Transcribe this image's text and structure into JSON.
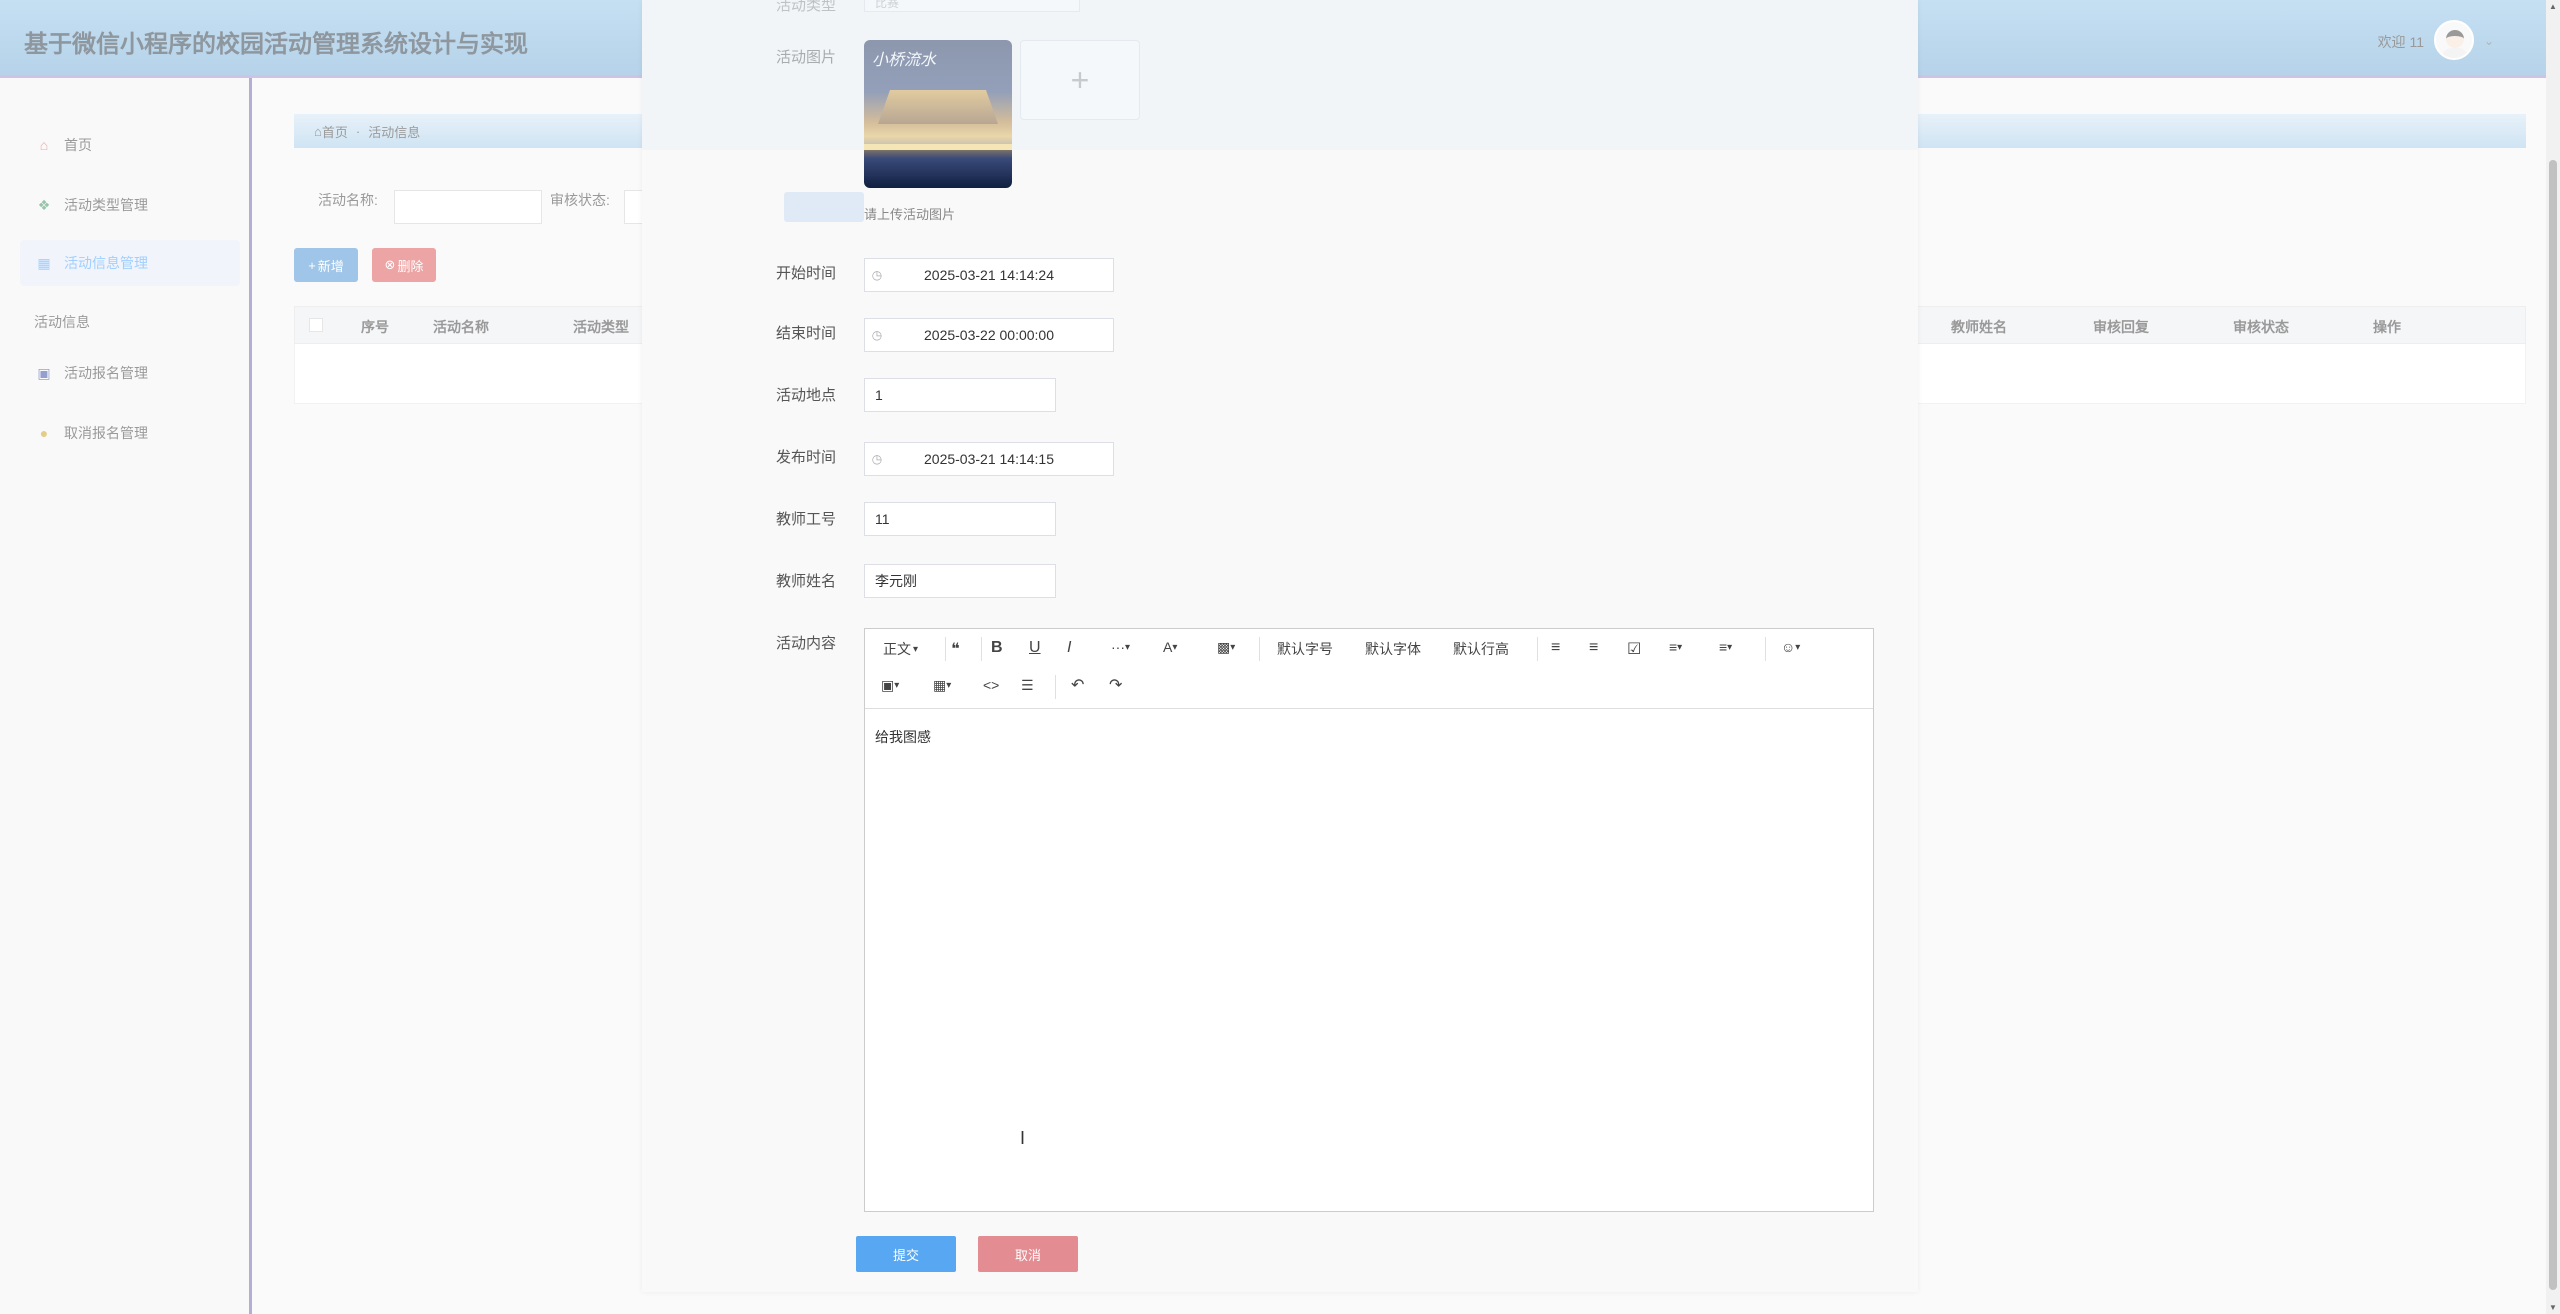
{
  "header": {
    "title": "基于微信小程序的校园活动管理系统设计与实现",
    "welcome": "欢迎 11"
  },
  "sidebar": {
    "items": [
      {
        "label": "首页",
        "icon": "home-icon"
      },
      {
        "label": "活动类型管理",
        "icon": "tag-icon"
      },
      {
        "label": "活动信息管理",
        "icon": "table-icon"
      }
    ],
    "group_label": "活动信息",
    "group_items": [
      {
        "label": "活动报名管理",
        "icon": "bag-icon"
      },
      {
        "label": "取消报名管理",
        "icon": "coin-icon"
      }
    ]
  },
  "breadcrumb": {
    "home": "首页",
    "sep": "·",
    "current": "活动信息"
  },
  "filters": {
    "name_label": "活动名称:",
    "status_label": "审核状态:"
  },
  "actions": {
    "add": "新增",
    "delete": "删除"
  },
  "table": {
    "headers": [
      "序号",
      "活动名称",
      "活动类型",
      "教师姓名",
      "审核回复",
      "审核状态",
      "操作"
    ]
  },
  "form": {
    "type_label": "活动类型",
    "type_value": "比赛",
    "image_label": "活动图片",
    "image_caption": "小桥流水",
    "image_hint": "请上传活动图片",
    "start_label": "开始时间",
    "start_value": "2025-03-21 14:14:24",
    "end_label": "结束时间",
    "end_value": "2025-03-22 00:00:00",
    "location_label": "活动地点",
    "location_value": "1",
    "publish_label": "发布时间",
    "publish_value": "2025-03-21 14:14:15",
    "teacher_id_label": "教师工号",
    "teacher_id_value": "11",
    "teacher_name_label": "教师姓名",
    "teacher_name_value": "李元刚",
    "content_label": "活动内容",
    "content_value": "给我图感",
    "submit": "提交",
    "cancel": "取消"
  },
  "editor_toolbar": {
    "paragraph": "正文",
    "font_size": "默认字号",
    "font_family": "默认字体",
    "line_height": "默认行高"
  }
}
